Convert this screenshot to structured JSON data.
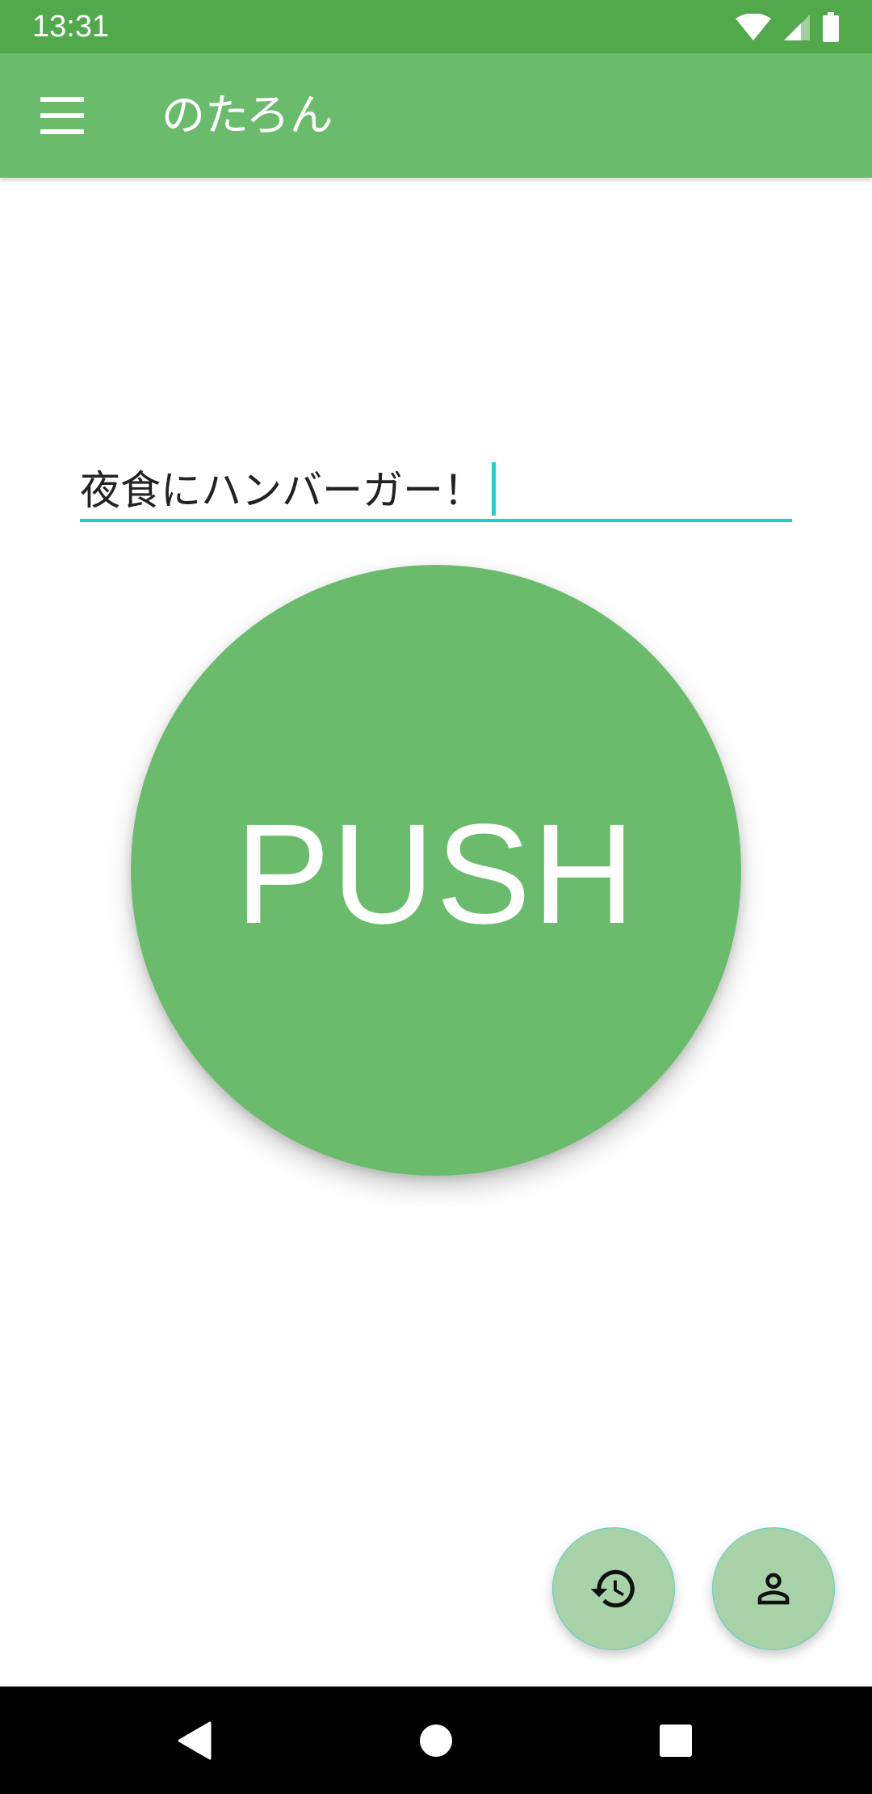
{
  "status_bar": {
    "time": "13:31",
    "icons": [
      "wifi-icon",
      "cell-signal-icon",
      "battery-icon"
    ]
  },
  "app_bar": {
    "title": "のたろん",
    "menu_icon": "menu-icon"
  },
  "message_input": {
    "value": "夜食にハンバーガー！"
  },
  "push_button": {
    "label": "PUSH"
  },
  "fabs": {
    "history_icon": "history-icon",
    "profile_icon": "person-icon"
  },
  "nav_bar": {
    "icons": [
      "back-icon",
      "home-icon",
      "recents-icon"
    ]
  },
  "colors": {
    "status_bar": "#52a94c",
    "app_bar": "#6abc6c",
    "accent": "#1fd0c8",
    "push_button": "#6abc6c",
    "fab": "#a8d3a8"
  }
}
